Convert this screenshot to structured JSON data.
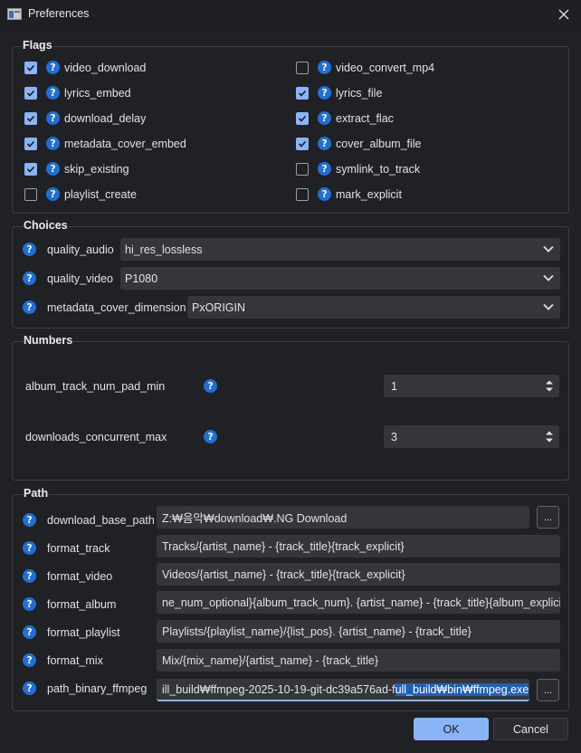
{
  "window": {
    "title": "Preferences"
  },
  "flags": {
    "title": "Flags",
    "items": [
      {
        "label": "video_download",
        "checked": true
      },
      {
        "label": "video_convert_mp4",
        "checked": false
      },
      {
        "label": "lyrics_embed",
        "checked": true
      },
      {
        "label": "lyrics_file",
        "checked": true
      },
      {
        "label": "download_delay",
        "checked": true
      },
      {
        "label": "extract_flac",
        "checked": true
      },
      {
        "label": "metadata_cover_embed",
        "checked": true
      },
      {
        "label": "cover_album_file",
        "checked": true
      },
      {
        "label": "skip_existing",
        "checked": true
      },
      {
        "label": "symlink_to_track",
        "checked": false
      },
      {
        "label": "playlist_create",
        "checked": false
      },
      {
        "label": "mark_explicit",
        "checked": false
      }
    ]
  },
  "choices": {
    "title": "Choices",
    "items": [
      {
        "label": "quality_audio",
        "value": "hi_res_lossless"
      },
      {
        "label": "quality_video",
        "value": "P1080"
      },
      {
        "label": "metadata_cover_dimension",
        "value": "PxORIGIN"
      }
    ]
  },
  "numbers": {
    "title": "Numbers",
    "items": [
      {
        "label": "album_track_num_pad_min",
        "value": "1"
      },
      {
        "label": "downloads_concurrent_max",
        "value": "3"
      }
    ]
  },
  "path": {
    "title": "Path",
    "items": [
      {
        "label": "download_base_path",
        "value": "Z:₩음악₩download₩.NG Download"
      },
      {
        "label": "format_track",
        "value": "Tracks/{artist_name} - {track_title}{track_explicit}"
      },
      {
        "label": "format_video",
        "value": "Videos/{artist_name} - {track_title}{track_explicit}"
      },
      {
        "label": "format_album",
        "value": "ne_num_optional}{album_track_num}. {artist_name} - {track_title}{album_explicit}"
      },
      {
        "label": "format_playlist",
        "value": "Playlists/{playlist_name}/{list_pos}. {artist_name} - {track_title}"
      },
      {
        "label": "format_mix",
        "value": "Mix/{mix_name}/{artist_name} - {track_title}"
      },
      {
        "label": "path_binary_ffmpeg",
        "value_plain": "ill_build₩ffmpeg-2025-10-19-git-dc39a576ad-f",
        "value_selected": "ull_build₩bin₩ffmpeg.exe"
      }
    ],
    "browse_label": "..."
  },
  "buttons": {
    "ok": "OK",
    "cancel": "Cancel"
  },
  "icons": {
    "help": "?"
  },
  "colors": {
    "accent": "#8ab4f8",
    "help": "#1f6fd6",
    "background": "#202124"
  }
}
